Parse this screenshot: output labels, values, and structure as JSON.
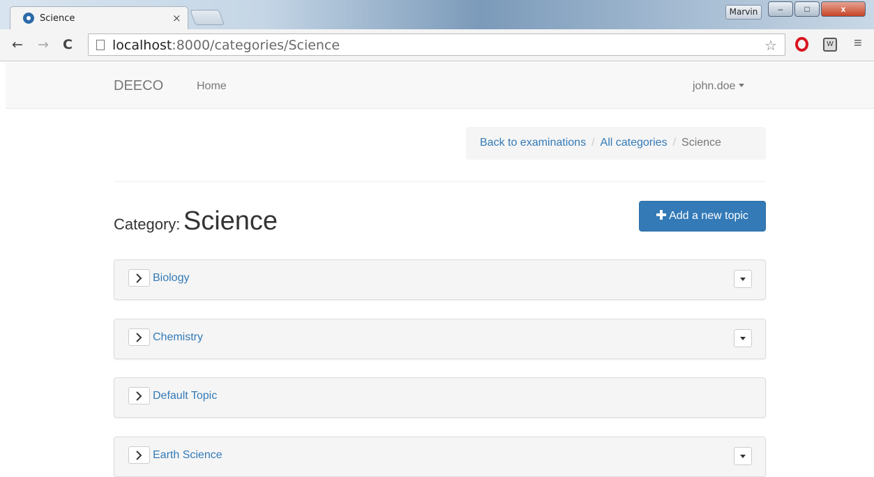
{
  "browser": {
    "tab_title": "Science",
    "tab_close": "×",
    "profile": "Marvin",
    "url_host": "localhost",
    "url_path": ":8000/categories/Science",
    "window_controls": {
      "minimize": "–",
      "maximize": "□",
      "close": "x"
    }
  },
  "navbar": {
    "brand": "DEECO",
    "home": "Home",
    "user": "john.doe"
  },
  "breadcrumb": {
    "items": [
      {
        "label": "Back to examinations",
        "link": true
      },
      {
        "label": "All categories",
        "link": true
      },
      {
        "label": "Science",
        "link": false
      }
    ],
    "separator": "/"
  },
  "page": {
    "title_label": "Category:",
    "title_name": "Science",
    "add_button": "Add a new topic"
  },
  "topics": [
    {
      "name": "Biology",
      "has_menu": true
    },
    {
      "name": "Chemistry",
      "has_menu": true
    },
    {
      "name": "Default Topic",
      "has_menu": false
    },
    {
      "name": "Earth Science",
      "has_menu": true
    }
  ],
  "colors": {
    "link": "#337ab7",
    "primary_button": "#337ab7",
    "panel_bg": "#f5f5f5"
  }
}
